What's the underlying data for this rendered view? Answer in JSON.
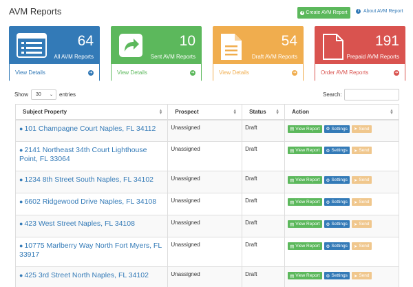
{
  "header": {
    "title": "AVM Reports",
    "create_label": "Create AVM Report",
    "about_label": "About AVM Report"
  },
  "cards": [
    {
      "value": "64",
      "label": "All AVM Reports",
      "footer": "View Details",
      "icon": "list-icon",
      "color": "#337ab7"
    },
    {
      "value": "10",
      "label": "Sent AVM Reports",
      "footer": "View Details",
      "icon": "share-icon",
      "color": "#5cb85c"
    },
    {
      "value": "54",
      "label": "Draft AVM Reports",
      "footer": "View Details",
      "icon": "document-icon",
      "color": "#f0ad4e"
    },
    {
      "value": "191",
      "label": "Prepaid AVM Reports",
      "footer": "Order AVM Reports",
      "icon": "blank-page-icon",
      "color": "#d9534f"
    }
  ],
  "table_controls": {
    "show_label": "Show",
    "page_size": "30",
    "entries_label": "entries",
    "search_label": "Search:"
  },
  "table": {
    "columns": [
      "Subject Property",
      "Prospect",
      "Status",
      "Action"
    ],
    "actions": {
      "view": "View Report",
      "settings": "Settings",
      "send": "Send"
    },
    "rows": [
      {
        "address": "101 Champagne Court Naples, FL 34112",
        "prospect": "Unassigned",
        "status": "Draft"
      },
      {
        "address": "2141 Northeast 34th Court Lighthouse Point, FL 33064",
        "prospect": "Unassigned",
        "status": "Draft"
      },
      {
        "address": "1234 8th Street South Naples, FL 34102",
        "prospect": "Unassigned",
        "status": "Draft"
      },
      {
        "address": "6602 Ridgewood Drive Naples, FL 34108",
        "prospect": "Unassigned",
        "status": "Draft"
      },
      {
        "address": "423 West Street Naples, FL 34108",
        "prospect": "Unassigned",
        "status": "Draft"
      },
      {
        "address": "10775 Marlberry Way North Fort Myers, FL 33917",
        "prospect": "Unassigned",
        "status": "Draft"
      },
      {
        "address": "425 3rd Street North Naples, FL 34102",
        "prospect": "Unassigned",
        "status": "Draft"
      }
    ]
  },
  "colors": {
    "primary": "#337ab7",
    "success": "#5cb85c",
    "warning": "#f0ad4e",
    "danger": "#d9534f"
  }
}
